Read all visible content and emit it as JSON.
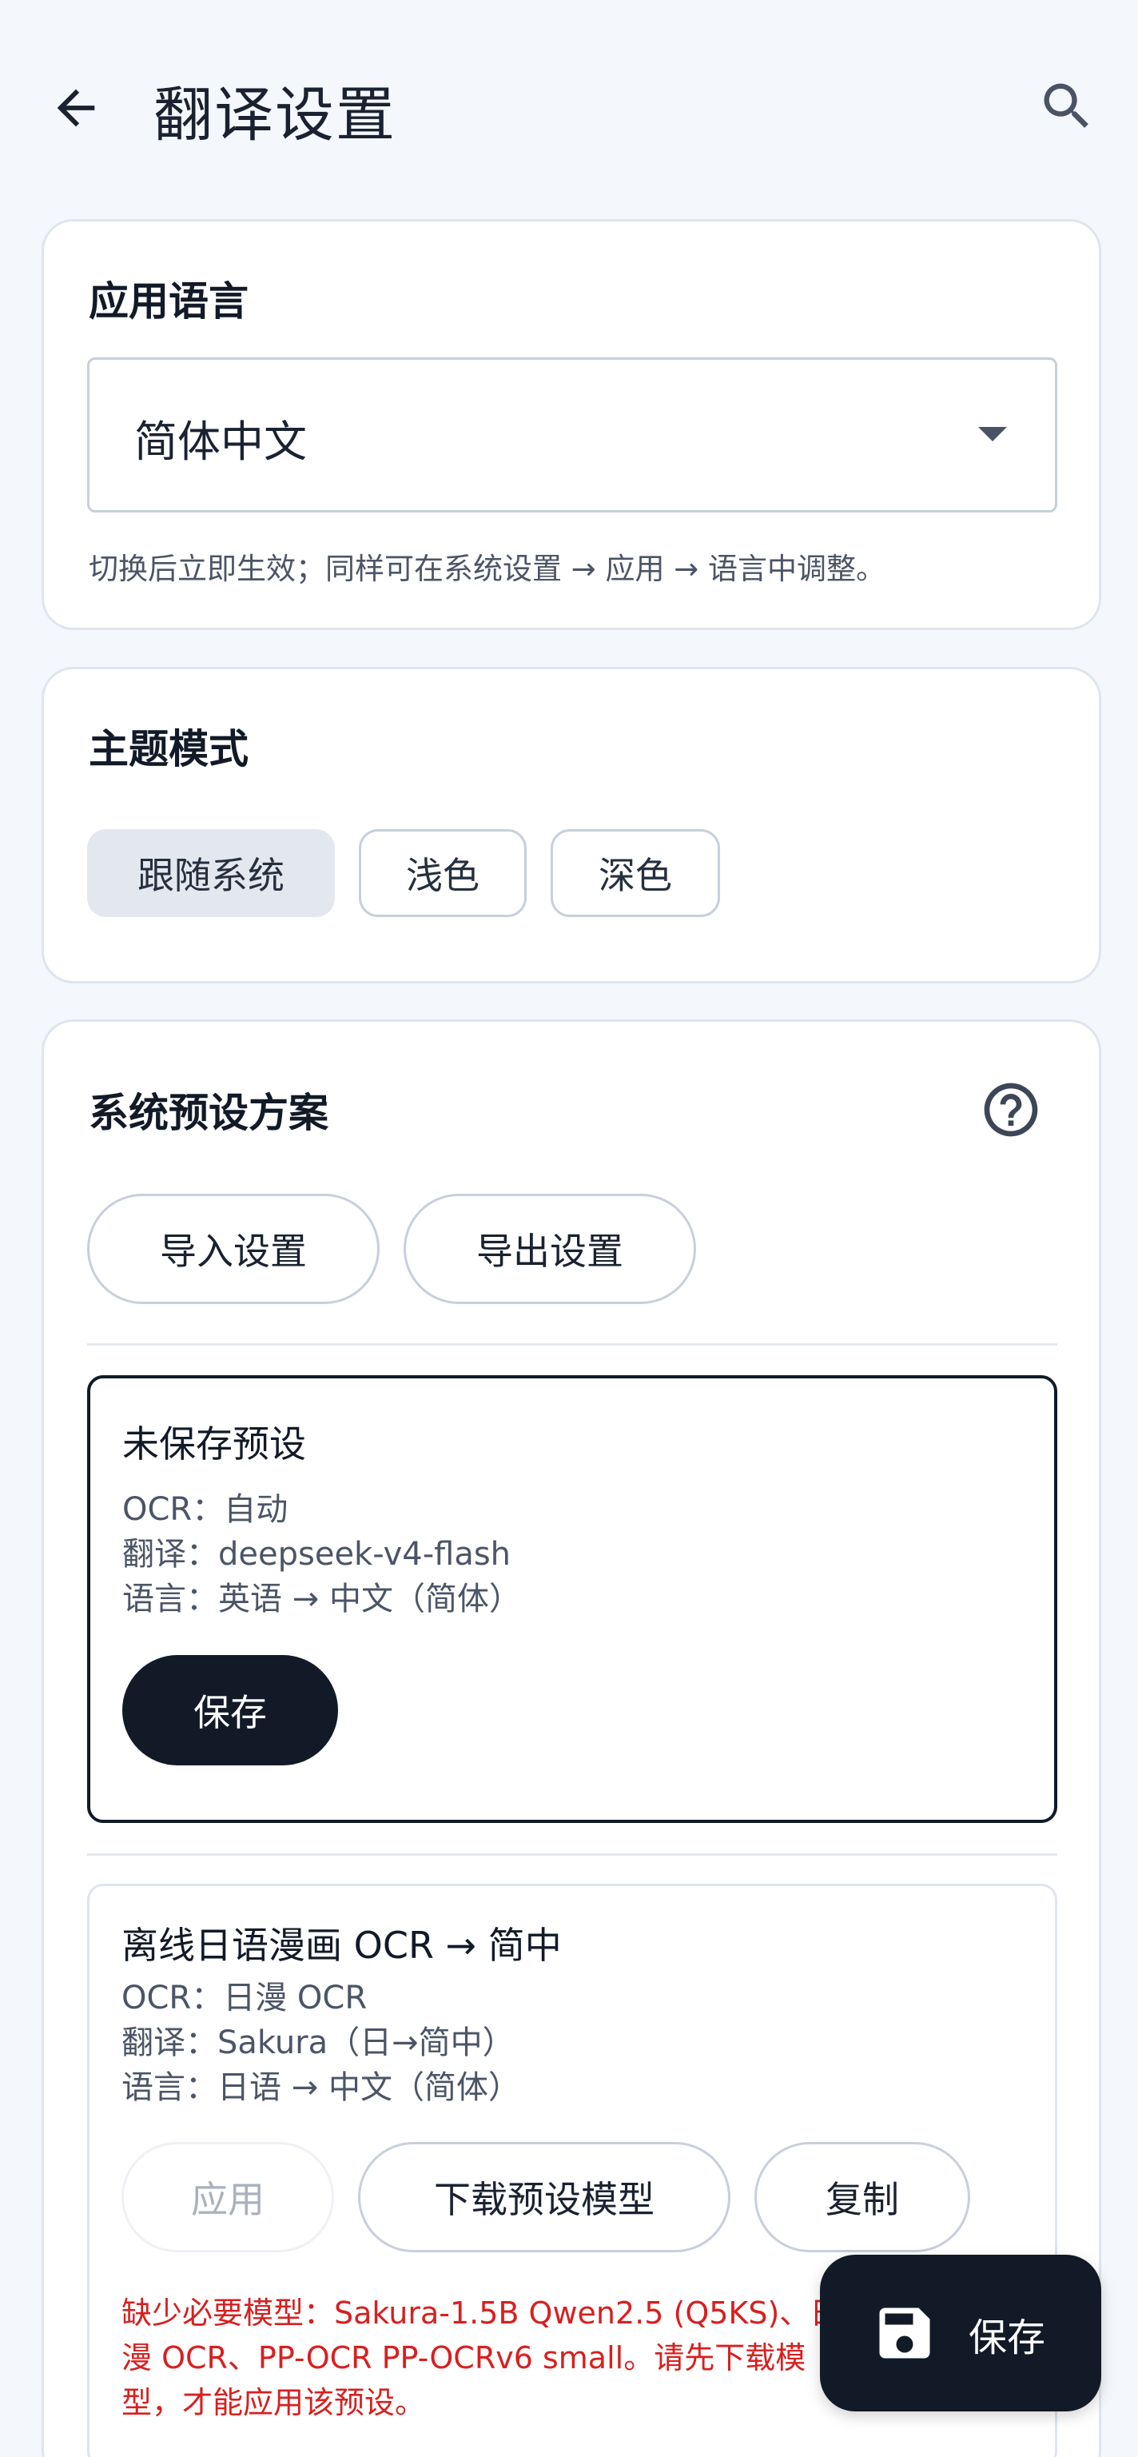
{
  "header": {
    "title": "翻译设置",
    "back_icon": "arrow-left-icon",
    "search_icon": "search-icon"
  },
  "app_language": {
    "title": "应用语言",
    "selected": "简体中文",
    "helper": "切换后立即生效；同样可在系统设置 → 应用 → 语言中调整。"
  },
  "theme": {
    "title": "主题模式",
    "options": [
      "跟随系统",
      "浅色",
      "深色"
    ],
    "selected": "跟随系统"
  },
  "presets": {
    "title": "系统预设方案",
    "help_icon": "help-circle-icon",
    "import_label": "导入设置",
    "export_label": "导出设置",
    "unsaved": {
      "name": "未保存预设",
      "ocr": "OCR：自动",
      "translate": "翻译：deepseek-v4-flash",
      "language": "语言：英语 → 中文（简体）",
      "save_label": "保存"
    },
    "offline": {
      "name": "离线日语漫画 OCR → 简中",
      "ocr": "OCR：日漫 OCR",
      "translate": "翻译：Sakura（日→简中）",
      "language": "语言：日语 → 中文（简体）",
      "apply_label": "应用",
      "download_label": "下载预设模型",
      "copy_label": "复制",
      "warning": "缺少必要模型：Sakura-1.5B Qwen2.5 (Q5KS)、日漫 OCR、PP-OCR PP-OCRv6 small。请先下载模型，才能应用该预设。"
    }
  },
  "fab": {
    "label": "保存",
    "icon": "floppy-disk-icon"
  },
  "colors": {
    "background": "#f4f7fb",
    "primary": "#121a28",
    "warning": "#d81f1f"
  }
}
